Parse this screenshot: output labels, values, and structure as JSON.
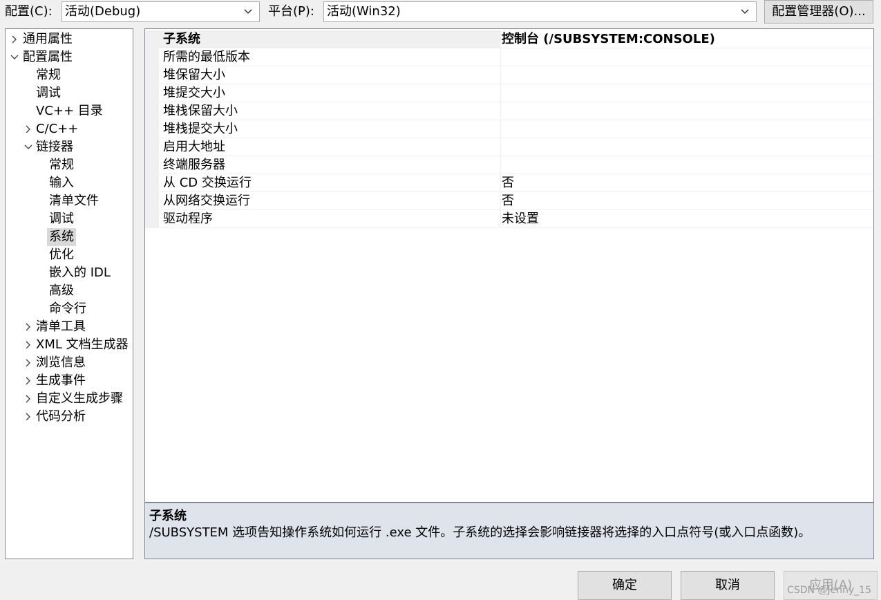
{
  "config_bar": {
    "config_label": "配置(C):",
    "config_value": "活动(Debug)",
    "platform_label": "平台(P):",
    "platform_value": "活动(Win32)",
    "manager_button": "配置管理器(O)..."
  },
  "tree": {
    "items": [
      {
        "label": "通用属性",
        "arrow": "right"
      },
      {
        "label": "配置属性",
        "arrow": "down"
      },
      {
        "label": "常规"
      },
      {
        "label": "调试"
      },
      {
        "label": "VC++ 目录"
      },
      {
        "label": "C/C++",
        "arrow": "right"
      },
      {
        "label": "链接器",
        "arrow": "down"
      },
      {
        "label": "常规"
      },
      {
        "label": "输入"
      },
      {
        "label": "清单文件"
      },
      {
        "label": "调试"
      },
      {
        "label": "系统",
        "selected": true
      },
      {
        "label": "优化"
      },
      {
        "label": "嵌入的 IDL"
      },
      {
        "label": "高级"
      },
      {
        "label": "命令行"
      },
      {
        "label": "清单工具",
        "arrow": "right"
      },
      {
        "label": "XML 文档生成器",
        "arrow": "right"
      },
      {
        "label": "浏览信息",
        "arrow": "right"
      },
      {
        "label": "生成事件",
        "arrow": "right"
      },
      {
        "label": "自定义生成步骤",
        "arrow": "right"
      },
      {
        "label": "代码分析",
        "arrow": "right"
      }
    ]
  },
  "properties": {
    "rows": [
      {
        "name": "子系统",
        "value": "控制台 (/SUBSYSTEM:CONSOLE)"
      },
      {
        "name": "所需的最低版本",
        "value": ""
      },
      {
        "name": "堆保留大小",
        "value": ""
      },
      {
        "name": "堆提交大小",
        "value": ""
      },
      {
        "name": "堆栈保留大小",
        "value": ""
      },
      {
        "name": "堆栈提交大小",
        "value": ""
      },
      {
        "name": "启用大地址",
        "value": ""
      },
      {
        "name": "终端服务器",
        "value": ""
      },
      {
        "name": "从 CD 交换运行",
        "value": "否"
      },
      {
        "name": "从网络交换运行",
        "value": "否"
      },
      {
        "name": "驱动程序",
        "value": "未设置"
      }
    ]
  },
  "description": {
    "title": "子系统",
    "text": "/SUBSYSTEM 选项告知操作系统如何运行 .exe 文件。子系统的选择会影响链接器将选择的入口点符号(或入口点函数)。"
  },
  "buttons": {
    "ok": "确定",
    "cancel": "取消",
    "apply": "应用(A)"
  },
  "watermark": "CSDN @Jenny_15",
  "colors": {
    "window_bg": "#f0f0f0",
    "selected_bg": "#d9d9d9",
    "description_bg": "#dfe3ec",
    "disabled_text": "#a0a0a0"
  }
}
